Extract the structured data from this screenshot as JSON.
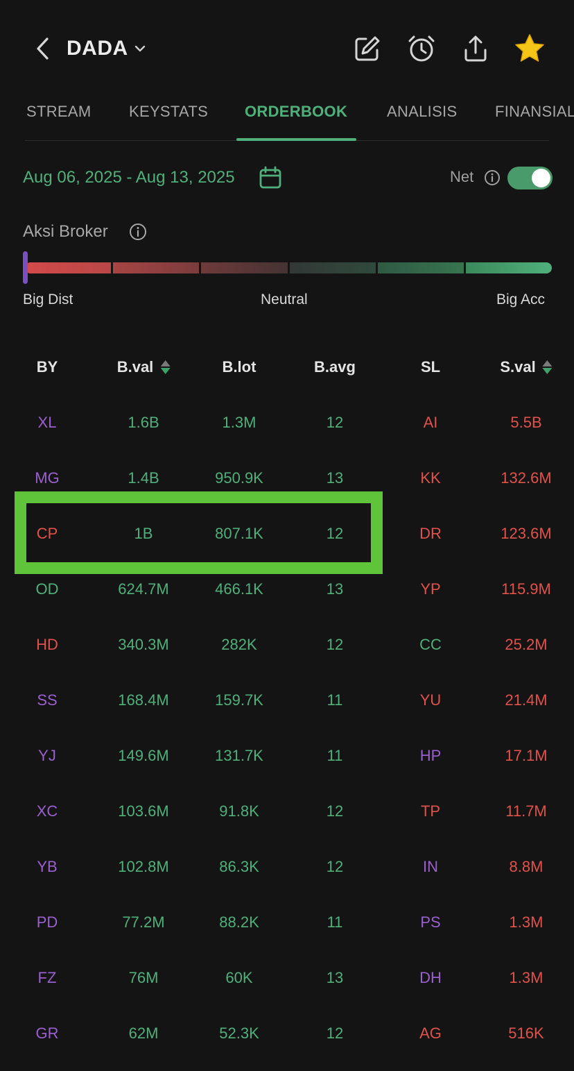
{
  "header": {
    "ticker": "DADA",
    "icons": [
      "chevron-left-icon",
      "chevron-down-icon",
      "edit-icon",
      "alarm-icon",
      "share-icon",
      "star-icon"
    ]
  },
  "tabs": [
    {
      "label": "STREAM",
      "active": false
    },
    {
      "label": "KEYSTATS",
      "active": false
    },
    {
      "label": "ORDERBOOK",
      "active": true
    },
    {
      "label": "ANALISIS",
      "active": false
    },
    {
      "label": "FINANSIAL",
      "active": false
    }
  ],
  "filters": {
    "date_range": "Aug 06, 2025 - Aug 13, 2025",
    "net_label": "Net",
    "net_on": true
  },
  "aksi_broker": {
    "title": "Aksi Broker",
    "left_label": "Big Dist",
    "mid_label": "Neutral",
    "right_label": "Big Acc",
    "level": 0.0
  },
  "table": {
    "headers": [
      "BY",
      "B.val",
      "B.lot",
      "B.avg",
      "SL",
      "S.val"
    ],
    "rows": [
      {
        "by": "XL",
        "bval": "1.6B",
        "blot": "1.3M",
        "bavg": "12",
        "sl": "AI",
        "sval": "5.5B",
        "by_color": "purple",
        "sl_color": "red"
      },
      {
        "by": "MG",
        "bval": "1.4B",
        "blot": "950.9K",
        "bavg": "13",
        "sl": "KK",
        "sval": "132.6M",
        "by_color": "purple",
        "sl_color": "red"
      },
      {
        "by": "CP",
        "bval": "1B",
        "blot": "807.1K",
        "bavg": "12",
        "sl": "DR",
        "sval": "123.6M",
        "by_color": "red",
        "sl_color": "red"
      },
      {
        "by": "OD",
        "bval": "624.7M",
        "blot": "466.1K",
        "bavg": "13",
        "sl": "YP",
        "sval": "115.9M",
        "by_color": "green",
        "sl_color": "red"
      },
      {
        "by": "HD",
        "bval": "340.3M",
        "blot": "282K",
        "bavg": "12",
        "sl": "CC",
        "sval": "25.2M",
        "by_color": "red",
        "sl_color": "green"
      },
      {
        "by": "SS",
        "bval": "168.4M",
        "blot": "159.7K",
        "bavg": "11",
        "sl": "YU",
        "sval": "21.4M",
        "by_color": "purple",
        "sl_color": "red"
      },
      {
        "by": "YJ",
        "bval": "149.6M",
        "blot": "131.7K",
        "bavg": "11",
        "sl": "HP",
        "sval": "17.1M",
        "by_color": "purple",
        "sl_color": "purple"
      },
      {
        "by": "XC",
        "bval": "103.6M",
        "blot": "91.8K",
        "bavg": "12",
        "sl": "TP",
        "sval": "11.7M",
        "by_color": "purple",
        "sl_color": "red"
      },
      {
        "by": "YB",
        "bval": "102.8M",
        "blot": "86.3K",
        "bavg": "12",
        "sl": "IN",
        "sval": "8.8M",
        "by_color": "purple",
        "sl_color": "purple"
      },
      {
        "by": "PD",
        "bval": "77.2M",
        "blot": "88.2K",
        "bavg": "11",
        "sl": "PS",
        "sval": "1.3M",
        "by_color": "purple",
        "sl_color": "purple"
      },
      {
        "by": "FZ",
        "bval": "76M",
        "blot": "60K",
        "bavg": "13",
        "sl": "DH",
        "sval": "1.3M",
        "by_color": "purple",
        "sl_color": "purple"
      },
      {
        "by": "GR",
        "bval": "62M",
        "blot": "52.3K",
        "bavg": "12",
        "sl": "AG",
        "sval": "516K",
        "by_color": "purple",
        "sl_color": "red"
      }
    ]
  },
  "colors": {
    "green": "#4fb07c",
    "red": "#e0524a",
    "purple": "#9b5fd0",
    "highlight": "#5fc43a",
    "background": "#141414"
  }
}
